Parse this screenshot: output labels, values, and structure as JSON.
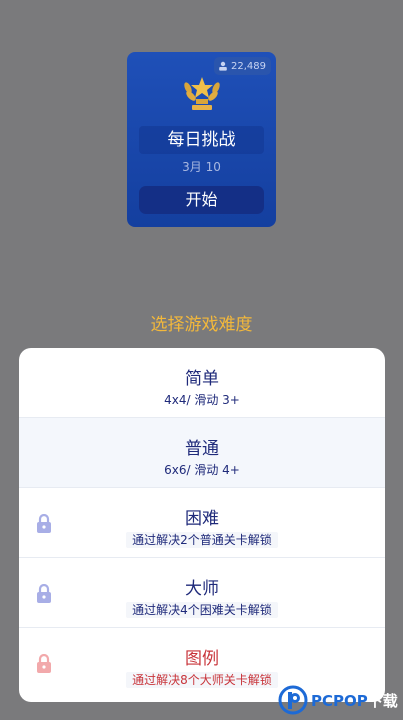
{
  "challenge": {
    "players": "22,489",
    "title": "每日挑战",
    "date": "3月 10",
    "start_label": "开始"
  },
  "difficulty_heading": "选择游戏难度",
  "levels": [
    {
      "name": "简单",
      "desc": "4x4/ 滑动 3+",
      "locked": false
    },
    {
      "name": "普通",
      "desc": "6x6/ 滑动 4+",
      "locked": false
    },
    {
      "name": "困难",
      "desc": "通过解决2个普通关卡解锁",
      "locked": true
    },
    {
      "name": "大师",
      "desc": "通过解决4个困难关卡解锁",
      "locked": true
    },
    {
      "name": "图例",
      "desc": "通过解决8个大师关卡解锁",
      "locked": true
    }
  ],
  "watermark": {
    "brand": "PCPOP",
    "suffix": "下载"
  },
  "colors": {
    "card_blue": "#1a47ab",
    "accent_gold": "#f3b83b",
    "text_navy": "#1f2a7a",
    "lock_purple": "#a8aee6",
    "legend_red": "#c8343a"
  }
}
